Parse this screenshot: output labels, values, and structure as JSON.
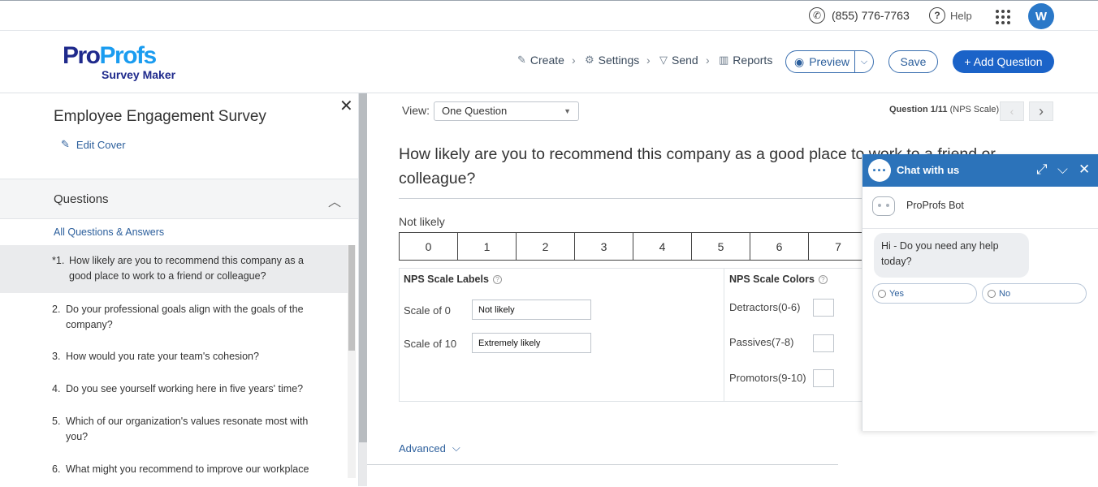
{
  "topbar": {
    "phone": "(855) 776-7763",
    "help": "Help",
    "avatar_initial": "W",
    "icons": [
      "phone-icon",
      "help-icon",
      "apps-grid-icon"
    ]
  },
  "header": {
    "logo": {
      "word1": "Pro",
      "word2": "Profs",
      "product": "Survey Maker"
    },
    "nav": {
      "create": "Create",
      "settings": "Settings",
      "send": "Send",
      "reports": "Reports"
    },
    "preview": "Preview",
    "save": "Save",
    "add_question": "+ Add Question",
    "colors": {
      "brand_dark": "#1f2a8c",
      "brand_light": "#1a9cf0",
      "primary": "#1b63c8"
    }
  },
  "sidebar": {
    "title": "Employee Engagement Survey",
    "edit_cover": "Edit Cover",
    "questions_header": "Questions",
    "all_qa": "All Questions & Answers",
    "questions": [
      {
        "num": "*1.",
        "text": "How likely are you to recommend this company as a good place to work to a friend or colleague?",
        "active": true
      },
      {
        "num": "2.",
        "text": "Do your professional goals align with the goals of the company?"
      },
      {
        "num": "3.",
        "text": "How would you rate your team's cohesion?"
      },
      {
        "num": "4.",
        "text": "Do you see yourself working here in five years' time?"
      },
      {
        "num": "5.",
        "text": "Which of our organization's values resonate most with you?"
      },
      {
        "num": "6.",
        "text": "What might you recommend to improve our workplace"
      }
    ]
  },
  "main": {
    "view_label": "View:",
    "view_value": "One Question",
    "question_counter": "Question 1/11",
    "question_type": "(NPS Scale)",
    "question_text": "How likely are you to recommend this company as a good place to work to a friend or colleague?",
    "not_likely_label": "Not likely",
    "scale": [
      "0",
      "1",
      "2",
      "3",
      "4",
      "5",
      "6",
      "7"
    ],
    "labels_header": "NPS Scale Labels",
    "scale0_label": "Scale of 0",
    "scale0_value": "Not likely",
    "scale10_label": "Scale of 10",
    "scale10_value": "Extremely likely",
    "colors_header": "NPS Scale Colors",
    "detractors": "Detractors(0-6)",
    "passives": "Passives(7-8)",
    "promotors": "Promotors(9-10)",
    "advanced": "Advanced"
  },
  "chat": {
    "title": "Chat with us",
    "bot_name": "ProProfs Bot",
    "message": "Hi - Do you need any help today?",
    "yes": "Yes",
    "no": "No",
    "header_color": "#2c73ba"
  }
}
